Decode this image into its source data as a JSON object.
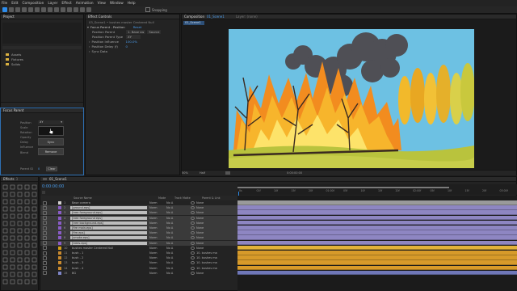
{
  "menu": [
    "File",
    "Edit",
    "Composition",
    "Layer",
    "Effect",
    "Animation",
    "View",
    "Window",
    "Help"
  ],
  "toolbar": {
    "snapping": "Snapping"
  },
  "project_panel": {
    "title": "Project",
    "items": [
      "Assets",
      "Fixtures",
      "Solids"
    ]
  },
  "effect_controls": {
    "tab": "Effect Controls",
    "layer_path": "03_Scene1 • bushes master Centered Null",
    "effect_name": "Focus Parent - Position",
    "reset": "Reset",
    "rows": [
      {
        "label": "Position Parent",
        "value": "1. Base sw",
        "value2": "Source"
      },
      {
        "label": "Position Parent Type",
        "value": "XY"
      },
      {
        "label": "Position Influence",
        "value": "100.0%"
      },
      {
        "label": "Position Delay (f)",
        "value": "0"
      },
      {
        "label": "Sync Data",
        "value": ""
      }
    ]
  },
  "composition": {
    "tab": "Composition",
    "comp_name": "01_Scene1",
    "layer_tab": "Layer: (none)",
    "breadcrumb": "01_Scene1",
    "zoom": "50%",
    "resolution": "Half",
    "timecode": "0:00:00:00",
    "timecode2": "0:00:00:00"
  },
  "focus_parent": {
    "title": "Focus Parent",
    "param_labels": [
      "Position",
      "Scale",
      "Rotation",
      "Opacity",
      "Delay",
      "Influence",
      "Blend"
    ],
    "position_value": "XY",
    "sync_label": "Sync",
    "remove_label": "Remove",
    "parent_id_label": "Parent ID",
    "parent_id_value": "0",
    "clear_label": "Clear"
  },
  "effects_panel": {
    "title": "Effects",
    "count": "3"
  },
  "timeline": {
    "comp_tab": "01_Scene1",
    "timecode": "0:00:00:00",
    "headers": {
      "source_name": "Source Name",
      "mode": "Mode",
      "trkmat": "Track Matte",
      "parent": "Parent & Link"
    },
    "ruler": [
      "0s",
      "01f",
      "10f",
      "15f",
      "20f",
      "01:00f",
      "05f",
      "10f",
      "15f",
      "20f",
      "02:00f",
      "05f",
      "10f",
      "15f",
      "20f",
      "03:00f"
    ],
    "layers": [
      {
        "num": "1",
        "name": "Base camera",
        "mode": "Norm",
        "trk": "No A",
        "parent": "None",
        "color": "#d2cfcf",
        "sel": false
      },
      {
        "num": "2",
        "name": "[ground.eps]",
        "mode": "Norm",
        "trk": "No A",
        "parent": "None",
        "color": "#8a5cc7",
        "sel": true
      },
      {
        "num": "3",
        "name": "[tree foreground.eps]",
        "mode": "Norm",
        "trk": "No A",
        "parent": "None",
        "color": "#8a5cc7",
        "sel": true
      },
      {
        "num": "4",
        "name": "[tree foreground eps]",
        "mode": "Norm",
        "trk": "No A",
        "parent": "None",
        "color": "#8a5cc7",
        "sel": true
      },
      {
        "num": "5",
        "name": "[tree background.eps]",
        "mode": "Norm",
        "trk": "No A",
        "parent": "None",
        "color": "#8a5cc7",
        "sel": true
      },
      {
        "num": "6",
        "name": "[fire main.eps]",
        "mode": "Norm",
        "trk": "No A",
        "parent": "None",
        "color": "#8a5cc7",
        "sel": true
      },
      {
        "num": "7",
        "name": "[fire.eps]",
        "mode": "Norm",
        "trk": "No A",
        "parent": "None",
        "color": "#8a5cc7",
        "sel": true
      },
      {
        "num": "8",
        "name": "[smoke.eps]",
        "mode": "Norm",
        "trk": "No A",
        "parent": "None",
        "color": "#8a5cc7",
        "sel": true
      },
      {
        "num": "9",
        "name": "[trees.eps]",
        "mode": "Norm",
        "trk": "No A",
        "parent": "None",
        "color": "#8a5cc7",
        "sel": true
      },
      {
        "num": "10",
        "name": "bushes master Centered Null",
        "mode": "Norm",
        "trk": "No A",
        "parent": "None",
        "color": "#d4a017",
        "sel": false
      },
      {
        "num": "11",
        "name": "bush - 1",
        "mode": "Norm",
        "trk": "No A",
        "parent": "10. bushes ma",
        "color": "#c98a2e",
        "sel": false
      },
      {
        "num": "12",
        "name": "bush - 2",
        "mode": "Norm",
        "trk": "No A",
        "parent": "10. bushes ma",
        "color": "#c98a2e",
        "sel": false
      },
      {
        "num": "13",
        "name": "bush - 3",
        "mode": "Norm",
        "trk": "No A",
        "parent": "10. bushes ma",
        "color": "#c98a2e",
        "sel": false
      },
      {
        "num": "14",
        "name": "bush - 4",
        "mode": "Norm",
        "trk": "No A",
        "parent": "10. bushes ma",
        "color": "#c98a2e",
        "sel": false
      },
      {
        "num": "15",
        "name": "BG",
        "mode": "Norm",
        "trk": "No A",
        "parent": "None",
        "color": "#7f86c8",
        "sel": false
      }
    ]
  },
  "colors": {
    "accent": "#2d8ceb",
    "purple_bar": "#8e86c2",
    "orange_bar": "#d79a2a",
    "yellow_bar": "#e1b23a",
    "selected_row": "#bdbdbd"
  }
}
